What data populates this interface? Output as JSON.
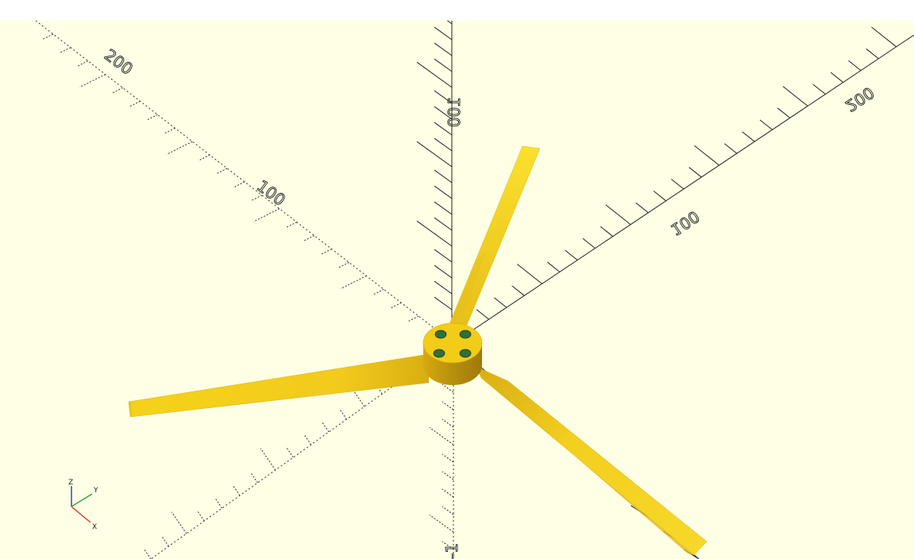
{
  "viewport": {
    "background": "#ffffe5",
    "tick_labels": {
      "y_neg_200": "200",
      "y_neg_100": "100",
      "z_100": "100",
      "x_100": "100",
      "x_200": "200",
      "z_neg": "-1"
    },
    "axes_indicator": {
      "x": "X",
      "y": "Y",
      "z": "Z"
    }
  },
  "model": {
    "name": "three-blade propeller with hub",
    "color": "#f5d315",
    "hub_holes": 4,
    "blades": 3
  }
}
